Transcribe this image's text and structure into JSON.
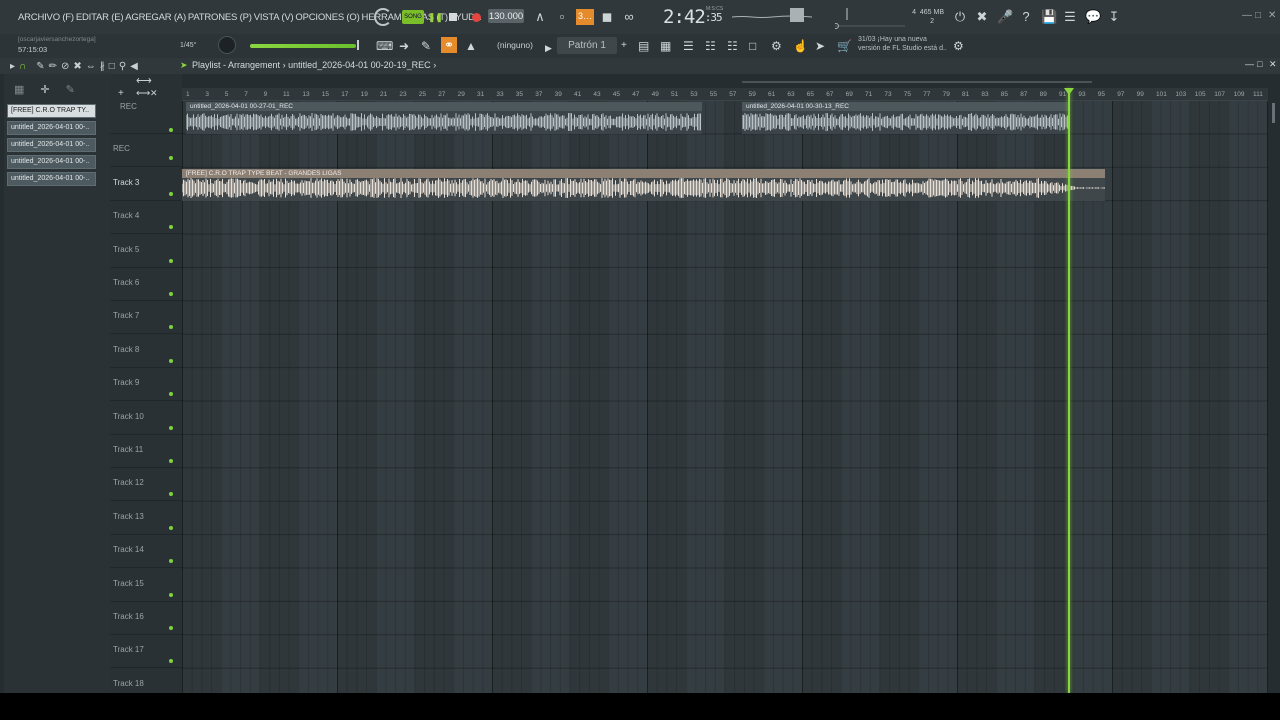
{
  "menu": [
    "ARCHIVO (F)",
    "EDITAR (E)",
    "AGREGAR (A)",
    "PATRONES (P)",
    "VISTA (V)",
    "OPCIONES (O)",
    "HERRAMIENTAS (T)",
    "AYUDA"
  ],
  "transport": {
    "mode_label": "SONG",
    "tempo": "130.000",
    "clock_main": "2:42",
    "clock_sub": ":35",
    "clock_unit": "M:S:CS",
    "memory": "465 MB",
    "cpu_num": "4",
    "poly": "2"
  },
  "hint": {
    "user": "[oscarjaviersanchezortega]",
    "time": "57:15:03",
    "pitch": "1/45°"
  },
  "toolbar2": {
    "snap": "(ninguno)",
    "pattern": "Patrón 1"
  },
  "news": {
    "date": "31/03",
    "line1": "¡Hay una nueva",
    "line2": "versión de FL Studio está d.."
  },
  "playlist": {
    "title": "Playlist - Arrangement",
    "crumb": "untitled_2026-04-01 00-20-19_REC"
  },
  "clips_panel": [
    "[FREE] C.R.O TRAP TY..",
    "untitled_2026-04-01 00-..",
    "untitled_2026-04-01 00-..",
    "untitled_2026-04-01 00-..",
    "untitled_2026-04-01 00-.."
  ],
  "tracks": [
    "REC",
    "REC",
    "Track 3",
    "Track 4",
    "Track 5",
    "Track 6",
    "Track 7",
    "Track 8",
    "Track 9",
    "Track 10",
    "Track 11",
    "Track 12",
    "Track 13",
    "Track 14",
    "Track 15",
    "Track 16",
    "Track 17",
    "Track 18"
  ],
  "timeline_ticks": [
    "1",
    "3",
    "5",
    "7",
    "9",
    "11",
    "13",
    "15",
    "17",
    "19",
    "21",
    "23",
    "25",
    "27",
    "29",
    "31",
    "33",
    "35",
    "37",
    "39",
    "41",
    "43",
    "45",
    "47",
    "49",
    "51",
    "53",
    "55",
    "57",
    "59",
    "61",
    "63",
    "65",
    "67",
    "69",
    "71",
    "73",
    "75",
    "77",
    "79",
    "81",
    "83",
    "85",
    "87",
    "89",
    "91",
    "93",
    "95",
    "97",
    "99",
    "101",
    "103",
    "105",
    "107",
    "109",
    "111"
  ],
  "clips": {
    "rec1": "untitled_2026-04-01 00-27-01_REC",
    "rec2": "untitled_2026-04-01 00-30-13_REC",
    "beat": "[FREE] C.R.O TRAP TYPE BEAT - GRANDES LIGAS"
  },
  "colors": {
    "accent": "#8ad63f",
    "rec": "#e2463f",
    "beat_header": "#8c7f74"
  }
}
